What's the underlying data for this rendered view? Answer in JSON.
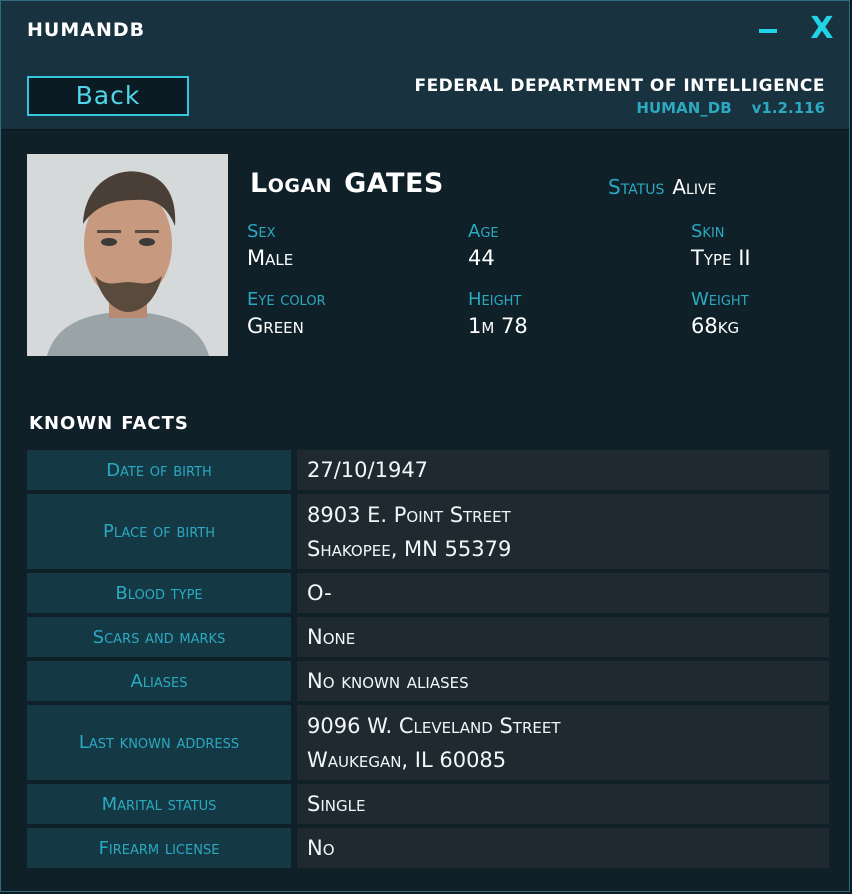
{
  "window": {
    "title": "HUMANDB",
    "minimize_label": "–",
    "close_label": "X"
  },
  "header": {
    "back_label": "Back",
    "agency": "FEDERAL DEPARTMENT OF INTELLIGENCE",
    "db_name": "HUMAN_DB",
    "version": "v1.2.116"
  },
  "profile": {
    "first_name": "Logan",
    "last_name": "GATES",
    "status_label": "Status",
    "status_value": "Alive",
    "attributes": [
      {
        "label": "Sex",
        "value": "Male"
      },
      {
        "label": "Age",
        "value": "44"
      },
      {
        "label": "Skin",
        "value": "Type II"
      },
      {
        "label": "Eye color",
        "value": "Green"
      },
      {
        "label": "Height",
        "value": "1m 78"
      },
      {
        "label": "Weight",
        "value": "68kg"
      }
    ]
  },
  "known_facts": {
    "title_word1": "KNOWN",
    "title_word2": "FACTS",
    "rows": [
      {
        "label": "Date of birth",
        "lines": [
          "27/10/1947"
        ]
      },
      {
        "label": "Place of birth",
        "lines": [
          "8903 E. Point Street",
          "Shakopee, MN 55379"
        ]
      },
      {
        "label": "Blood type",
        "lines": [
          "O-"
        ]
      },
      {
        "label": "Scars and marks",
        "lines": [
          "None"
        ]
      },
      {
        "label": "Aliases",
        "lines": [
          "No known aliases"
        ]
      },
      {
        "label": "Last known address",
        "lines": [
          "9096 W. Cleveland Street",
          "Waukegan, IL 60085"
        ]
      },
      {
        "label": "Marital status",
        "lines": [
          "Single"
        ]
      },
      {
        "label": "Firearm license",
        "lines": [
          "No"
        ]
      }
    ]
  }
}
